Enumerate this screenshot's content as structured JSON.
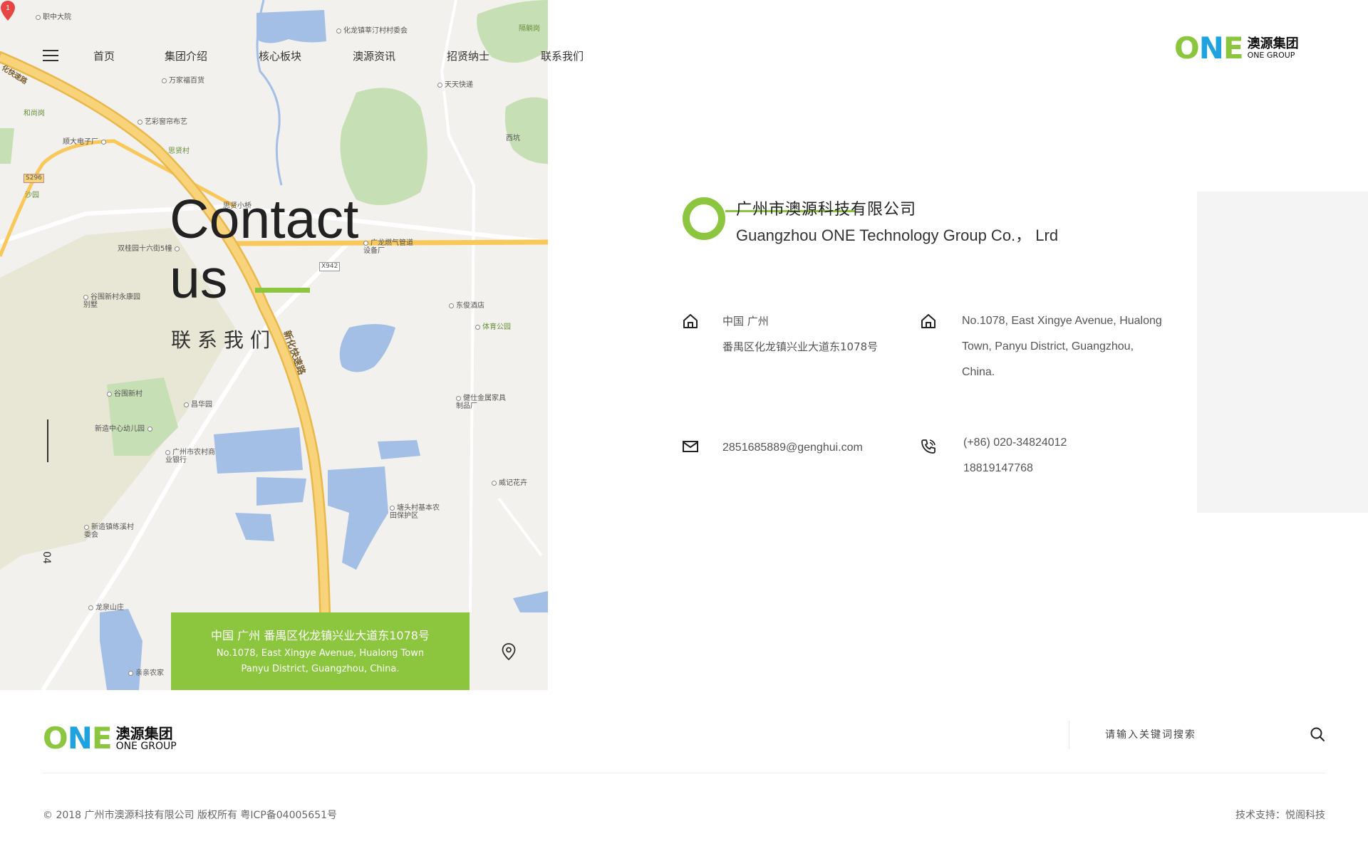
{
  "nav": {
    "items": [
      "首页",
      "集团介绍",
      "核心板块",
      "澳源资讯",
      "招贤纳士",
      "联系我们"
    ]
  },
  "logo": {
    "mark": "ONE",
    "cn": "澳源集团",
    "en": "ONE GROUP"
  },
  "hero": {
    "title_line1": "Contact",
    "title_line2": "us",
    "subtitle": "联系我们",
    "page_number": "04"
  },
  "map": {
    "pois": [
      "职中大院",
      "化龙镇莘汀村村委会",
      "隔躺岗",
      "万家福百货",
      "天天快递",
      "和尚岗",
      "艺彩窗帘布艺",
      "顺大电子厂",
      "思贤村",
      "西坑",
      "沙园",
      "思贤小桥",
      "广龙燃气管道设备厂",
      "双桂园十六街5幢",
      "谷围新村永康园别墅",
      "东俊酒店",
      "体育公园",
      "谷围新村",
      "昌华园",
      "健仕金属家具制品厂",
      "新造中心幼儿园",
      "广州市农村商业银行",
      "威记花卉",
      "塘头村基本农田保护区",
      "新造镇练溪村委会",
      "龙泉山庄",
      "亲亲农家"
    ],
    "road_labels": [
      "化快速路",
      "新化快速路",
      "X942",
      "S296"
    ],
    "marker_label": "1"
  },
  "address_banner": {
    "cn": "中国 广州 番禺区化龙镇兴业大道东1078号",
    "en_line1": "No.1078, East Xingye Avenue, Hualong Town",
    "en_line2": "Panyu District, Guangzhou, China."
  },
  "company": {
    "cn": "广州市澳源科技有限公司",
    "en": "Guangzhou ONE Technology Group Co.， Lrd"
  },
  "contact": {
    "address_cn_line1": "中国 广州",
    "address_cn_line2": "番禺区化龙镇兴业大道东1078号",
    "address_en_line1": "No.1078, East Xingye Avenue, Hualong",
    "address_en_line2": "Town, Panyu District, Guangzhou,",
    "address_en_line3": "China.",
    "email": "2851685889@genghui.com",
    "phone1": "(+86) 020-34824012",
    "phone2": "18819147768"
  },
  "footer": {
    "search_placeholder": "请输入关键词搜索",
    "copyright": "© 2018 广州市澳源科技有限公司 版权所有   粤ICP备04005651号",
    "tech_support": "技术支持：悦阁科技"
  },
  "colors": {
    "accent_green": "#8cc63f",
    "logo_blue": "#1fa3e0",
    "road_yellow": "#f8c85a",
    "water_blue": "#a3bfe6",
    "park_green": "#c6dfb4"
  }
}
